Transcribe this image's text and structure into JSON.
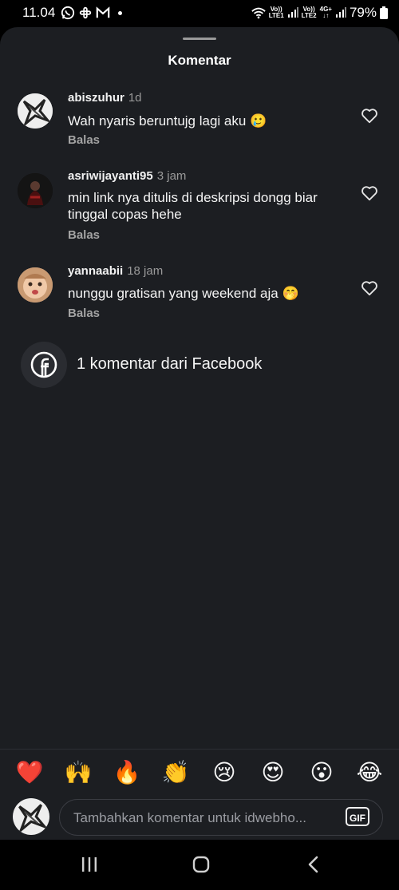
{
  "status_bar": {
    "time": "11.04",
    "battery": "79%",
    "sim1_label_top": "Vo))",
    "sim1_label_bottom": "LTE1",
    "sim2_label_top": "Vo))",
    "sim2_label_bottom": "LTE2",
    "network_label": "4G+"
  },
  "sheet": {
    "title": "Komentar"
  },
  "comments": [
    {
      "username": "abiszuhur",
      "time": "1d",
      "text": "Wah nyaris beruntujg lagi aku",
      "emoji": "🥲",
      "reply_label": "Balas"
    },
    {
      "username": "asriwijayanti95",
      "time": "3 jam",
      "text": "min link nya ditulis di deskripsi dongg biar tinggal copas hehe",
      "emoji": "",
      "reply_label": "Balas"
    },
    {
      "username": "yannaabii",
      "time": "18 jam",
      "text": "nunggu gratisan yang weekend aja",
      "emoji": "🤭",
      "reply_label": "Balas"
    }
  ],
  "facebook_comments": {
    "label": "1 komentar dari Facebook"
  },
  "emoji_bar": [
    "❤️",
    "🙌",
    "🔥",
    "👏",
    "😢",
    "😍",
    "😮",
    "😂"
  ],
  "comment_input": {
    "placeholder": "Tambahkan komentar untuk idwebho...",
    "gif_label": "GIF"
  },
  "colors": {
    "sheet_bg": "#1c1e22",
    "text": "#f5f5f5",
    "muted": "#9a9a9a"
  }
}
